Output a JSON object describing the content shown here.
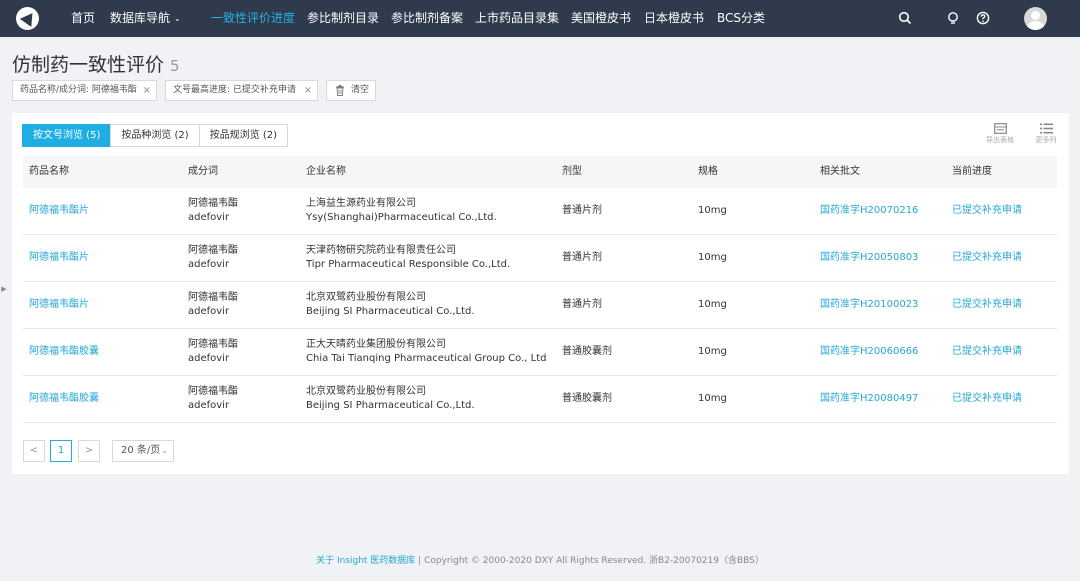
{
  "nav": {
    "items": [
      {
        "label": "首页",
        "active": false
      },
      {
        "label": "数据库导航",
        "active": false,
        "dropdown": true
      },
      {
        "label": "一致性评价进度",
        "active": true
      },
      {
        "label": "参比制剂目录",
        "active": false
      },
      {
        "label": "参比制剂备案",
        "active": false
      },
      {
        "label": "上市药品目录集",
        "active": false
      },
      {
        "label": "美国橙皮书",
        "active": false
      },
      {
        "label": "日本橙皮书",
        "active": false
      },
      {
        "label": "BCS分类",
        "active": false
      }
    ],
    "icons": [
      "search-icon",
      "lightbulb-icon",
      "help-icon",
      "user-avatar"
    ]
  },
  "page": {
    "title": "仿制药一致性评价",
    "count": "5"
  },
  "filters": [
    {
      "label": "药品名称/成分词: 阿德福韦酯",
      "close": "×"
    },
    {
      "label": "文号最高进度: 已提交补充申请",
      "close": "×"
    }
  ],
  "clear_label": "清空",
  "tabs": [
    {
      "label": "按文号浏览 (5)",
      "active": true
    },
    {
      "label": "按品种浏览 (2)",
      "active": false
    },
    {
      "label": "按品规浏览 (2)",
      "active": false
    }
  ],
  "tools": {
    "export": "导出表格",
    "columns": "更多列"
  },
  "table": {
    "columns": [
      "药品名称",
      "成分词",
      "企业名称",
      "剂型",
      "规格",
      "相关批文",
      "当前进度"
    ],
    "rows": [
      {
        "name": "阿德福韦酯片",
        "ingredient_cn": "阿德福韦酯",
        "ingredient_en": "adefovir",
        "company_cn": "上海益生源药业有限公司",
        "company_en": "Ysy(Shanghai)Pharmaceutical Co.,Ltd.",
        "form": "普通片剂",
        "spec": "10mg",
        "approval": "国药准字H20070216",
        "progress": "已提交补充申请"
      },
      {
        "name": "阿德福韦酯片",
        "ingredient_cn": "阿德福韦酯",
        "ingredient_en": "adefovir",
        "company_cn": "天津药物研究院药业有限责任公司",
        "company_en": "Tipr Pharmaceutical Responsible Co.,Ltd.",
        "form": "普通片剂",
        "spec": "10mg",
        "approval": "国药准字H20050803",
        "progress": "已提交补充申请"
      },
      {
        "name": "阿德福韦酯片",
        "ingredient_cn": "阿德福韦酯",
        "ingredient_en": "adefovir",
        "company_cn": "北京双鹭药业股份有限公司",
        "company_en": "Beijing SI Pharmaceutical Co.,Ltd.",
        "form": "普通片剂",
        "spec": "10mg",
        "approval": "国药准字H20100023",
        "progress": "已提交补充申请"
      },
      {
        "name": "阿德福韦酯胶囊",
        "ingredient_cn": "阿德福韦酯",
        "ingredient_en": "adefovir",
        "company_cn": "正大天晴药业集团股份有限公司",
        "company_en": "Chia Tai Tianqing Pharmaceutical Group Co., Ltd",
        "form": "普通胶囊剂",
        "spec": "10mg",
        "approval": "国药准字H20060666",
        "progress": "已提交补充申请"
      },
      {
        "name": "阿德福韦酯胶囊",
        "ingredient_cn": "阿德福韦酯",
        "ingredient_en": "adefovir",
        "company_cn": "北京双鹭药业股份有限公司",
        "company_en": "Beijing SI Pharmaceutical Co.,Ltd.",
        "form": "普通胶囊剂",
        "spec": "10mg",
        "approval": "国药准字H20080497",
        "progress": "已提交补充申请"
      }
    ]
  },
  "pagination": {
    "prev": "<",
    "current": "1",
    "next": ">",
    "page_size": "20 条/页"
  },
  "footer": {
    "about": "关于 Insight 医药数据库",
    "sep": " | ",
    "copyright": "Copyright © 2000-2020 DXY All Rights Reserved. 浙B2-20070219（含BBS）"
  },
  "colors": {
    "nav_bg": "#2f3a4d",
    "accent": "#1faee3",
    "link": "#25a7d8"
  }
}
